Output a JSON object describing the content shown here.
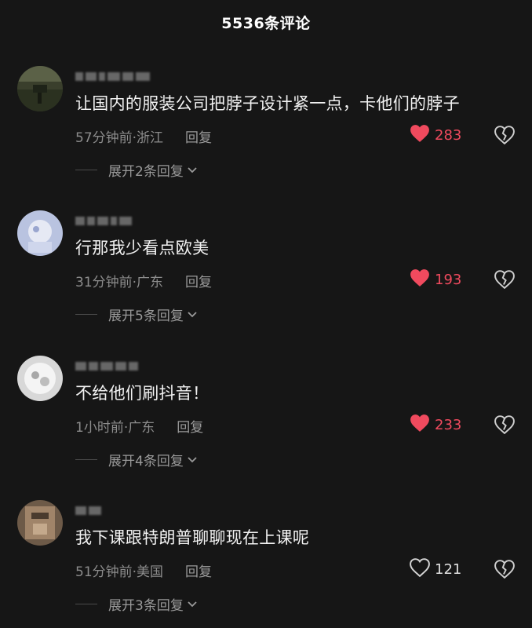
{
  "header": {
    "title": "5536条评论"
  },
  "comments": [
    {
      "text": "让国内的服装公司把脖子设计紧一点，卡他们的脖子",
      "time_location": "57分钟前·浙江",
      "reply_label": "回复",
      "likes": "283",
      "liked": true,
      "expand_label": "展开2条回复"
    },
    {
      "text": "行那我少看点欧美",
      "time_location": "31分钟前·广东",
      "reply_label": "回复",
      "likes": "193",
      "liked": true,
      "expand_label": "展开5条回复"
    },
    {
      "text": "不给他们刷抖音！",
      "time_location": "1小时前·广东",
      "reply_label": "回复",
      "likes": "233",
      "liked": true,
      "expand_label": "展开4条回复"
    },
    {
      "text": "我下课跟特朗普聊聊现在上课呢",
      "time_location": "51分钟前·美国",
      "reply_label": "回复",
      "likes": "121",
      "liked": false,
      "expand_label": "展开3条回复"
    }
  ],
  "colors": {
    "background": "#161616",
    "like_active": "#f04a5e",
    "text_secondary": "#8c8c8c"
  },
  "icons": {
    "like": "heart-icon",
    "dislike": "broken-heart-icon",
    "expand": "chevron-down-icon"
  }
}
